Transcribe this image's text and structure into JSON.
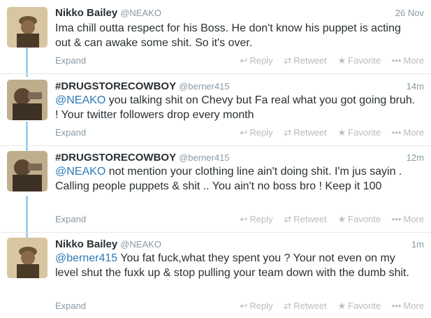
{
  "tweets": [
    {
      "name": "Nikko Bailey",
      "handle": "@NEAKO",
      "time": "26 Nov",
      "mention": "",
      "text": "Ima chill outta respect for his Boss. He don't know his puppet is acting out & can awake some shit. So it's over."
    },
    {
      "name": "#DRUGSTORECOWBOY",
      "handle": "@berner415",
      "time": "14m",
      "mention": "@NEAKO",
      "text": " you talking shit on Chevy but Fa real what you got going bruh. ! Your twitter followers drop every month"
    },
    {
      "name": "#DRUGSTORECOWBOY",
      "handle": "@berner415",
      "time": "12m",
      "mention": "@NEAKO",
      "text": " not mention your clothing line ain't doing shit. I'm jus sayin . Calling people puppets & shit .. You ain't no boss bro ! Keep it 100"
    },
    {
      "name": "Nikko Bailey",
      "handle": "@NEAKO",
      "time": "1m",
      "mention": "@berner415",
      "text": " You fat fuck,what they spent you ? Your not even on my level shut the fuxk up & stop pulling your team down with the dumb shit."
    }
  ],
  "labels": {
    "expand": "Expand",
    "reply": "Reply",
    "retweet": "Retweet",
    "favorite": "Favorite",
    "more": "More"
  },
  "icons": {
    "reply": "reply-arrow-icon",
    "retweet": "retweet-icon",
    "favorite": "star-icon",
    "more": "ellipsis-icon"
  },
  "colors": {
    "thread_line": "#9fd0ec",
    "mention": "#2b7bb9",
    "muted": "#8899a6"
  }
}
